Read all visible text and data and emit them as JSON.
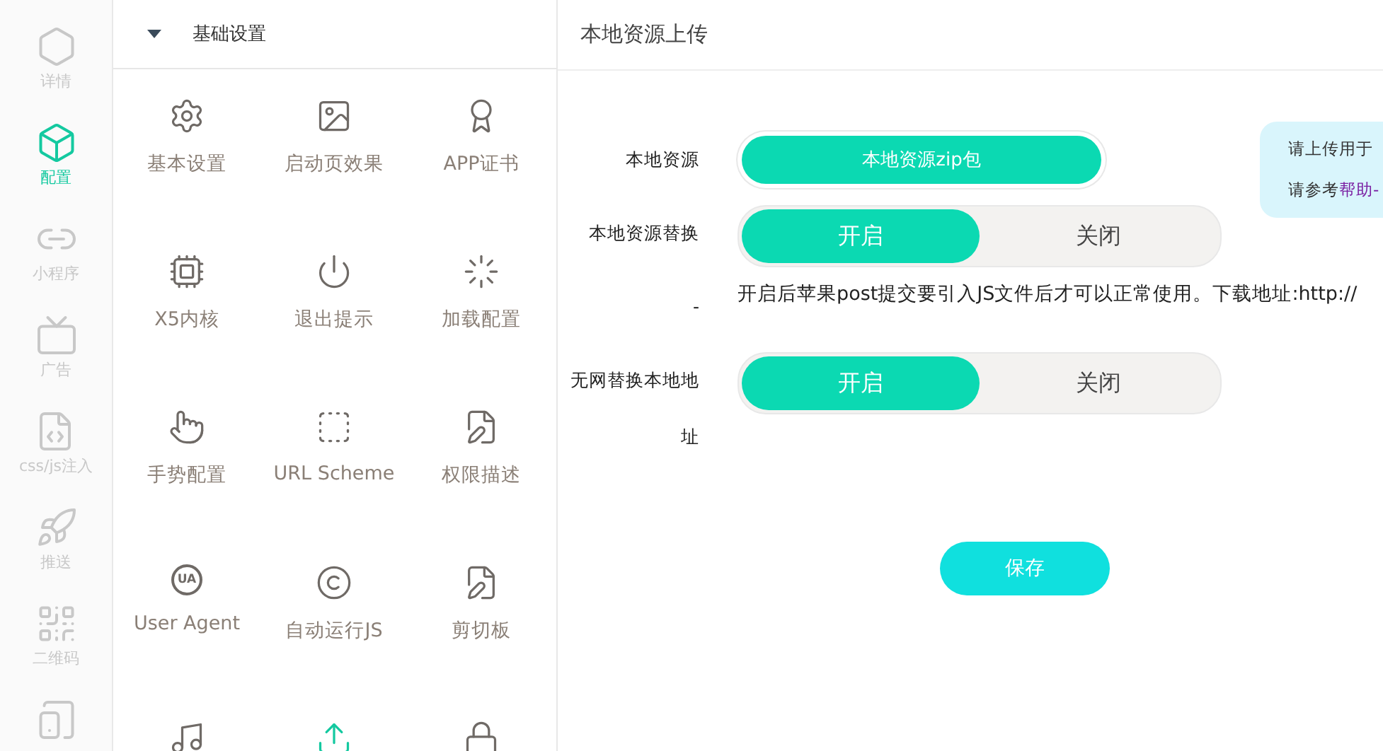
{
  "nav": [
    {
      "kind": "hexagon",
      "label": "详情",
      "selected": false
    },
    {
      "kind": "box",
      "label": "配置",
      "selected": true
    },
    {
      "kind": "mini",
      "label": "小程序",
      "selected": false
    },
    {
      "kind": "ad",
      "label": "广告",
      "selected": false
    },
    {
      "kind": "code",
      "label": "css/js注入",
      "selected": false
    },
    {
      "kind": "rocket",
      "label": "推送",
      "selected": false
    },
    {
      "kind": "qr",
      "label": "二维码",
      "selected": false
    },
    {
      "kind": "download",
      "selected": false
    }
  ],
  "section": {
    "title": "基础设置",
    "expanded": true
  },
  "grid": [
    {
      "kind": "gear",
      "label": "基本设置",
      "selected": false
    },
    {
      "kind": "image",
      "label": "启动页效果",
      "selected": false
    },
    {
      "kind": "award",
      "label": "APP证书",
      "selected": false
    },
    {
      "kind": "chip",
      "label": "X5内核",
      "selected": false
    },
    {
      "kind": "power",
      "label": "退出提示",
      "selected": false
    },
    {
      "kind": "loader",
      "label": "加载配置",
      "selected": false
    },
    {
      "kind": "hand",
      "label": "手势配置",
      "selected": false
    },
    {
      "kind": "scheme",
      "label": "URL Scheme",
      "selected": false
    },
    {
      "kind": "doc",
      "label": "权限描述",
      "selected": false
    },
    {
      "kind": "ua",
      "label": "User Agent",
      "badge": "UA",
      "selected": false
    },
    {
      "kind": "copyright",
      "label": "自动运行JS",
      "selected": false
    },
    {
      "kind": "doc",
      "label": "剪切板",
      "selected": false
    },
    {
      "kind": "music",
      "selected": false
    },
    {
      "kind": "upload",
      "selected": true
    },
    {
      "kind": "lock",
      "selected": false
    }
  ],
  "panel": {
    "title": "本地资源上传",
    "rows": [
      {
        "kind": "upload",
        "label": "本地资源",
        "button": "本地资源zip包"
      },
      {
        "kind": "toggle",
        "label": "本地资源替换",
        "options": [
          {
            "label": "开启",
            "selected": true
          },
          {
            "label": "关闭",
            "selected": false
          }
        ]
      },
      {
        "kind": "note",
        "label": "-",
        "text": "开启后苹果post提交要引入JS文件后才可以正常使用。下载地址:http://"
      },
      {
        "kind": "toggle",
        "label": "无网替换本地地址",
        "options": [
          {
            "label": "开启",
            "selected": true
          },
          {
            "label": "关闭",
            "selected": false
          }
        ]
      }
    ],
    "save": "保存",
    "tip": {
      "line1": "请上传用于",
      "line2": "请参考",
      "link": "帮助-"
    }
  }
}
